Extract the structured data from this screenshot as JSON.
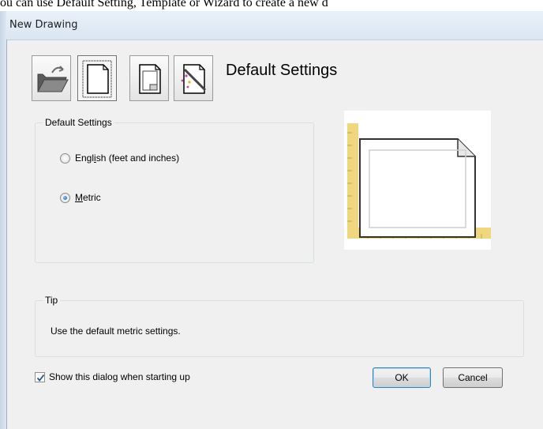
{
  "background_text": "ou can use Default Setting, Template or Wizard to create a new d",
  "window": {
    "title": "New Drawing"
  },
  "toolbar": {
    "buttons": [
      {
        "name": "open-drawing-button",
        "icon": "folder-open-icon"
      },
      {
        "name": "default-settings-button",
        "icon": "blank-page-icon",
        "selected": true
      },
      {
        "name": "template-button",
        "icon": "template-page-icon"
      },
      {
        "name": "wizard-button",
        "icon": "wizard-page-icon"
      }
    ]
  },
  "heading": "Default Settings",
  "settings_group": {
    "legend": "Default Settings",
    "options": [
      {
        "label": "English (feet and inches)",
        "mnemonic_index": 4,
        "selected": false
      },
      {
        "label": "Metric",
        "mnemonic_index": 0,
        "selected": true
      }
    ]
  },
  "tip_group": {
    "legend": "Tip",
    "text": "Use the default metric settings."
  },
  "footer": {
    "show_dialog_label": "Show this dialog when starting up",
    "show_dialog_checked": true,
    "ok_label": "OK",
    "cancel_label": "Cancel"
  },
  "colors": {
    "ruler": "#f0d67e",
    "ruler_ticks": "#c9a443",
    "page_border": "#333333",
    "dialog_bg": "#f0f0f0"
  }
}
